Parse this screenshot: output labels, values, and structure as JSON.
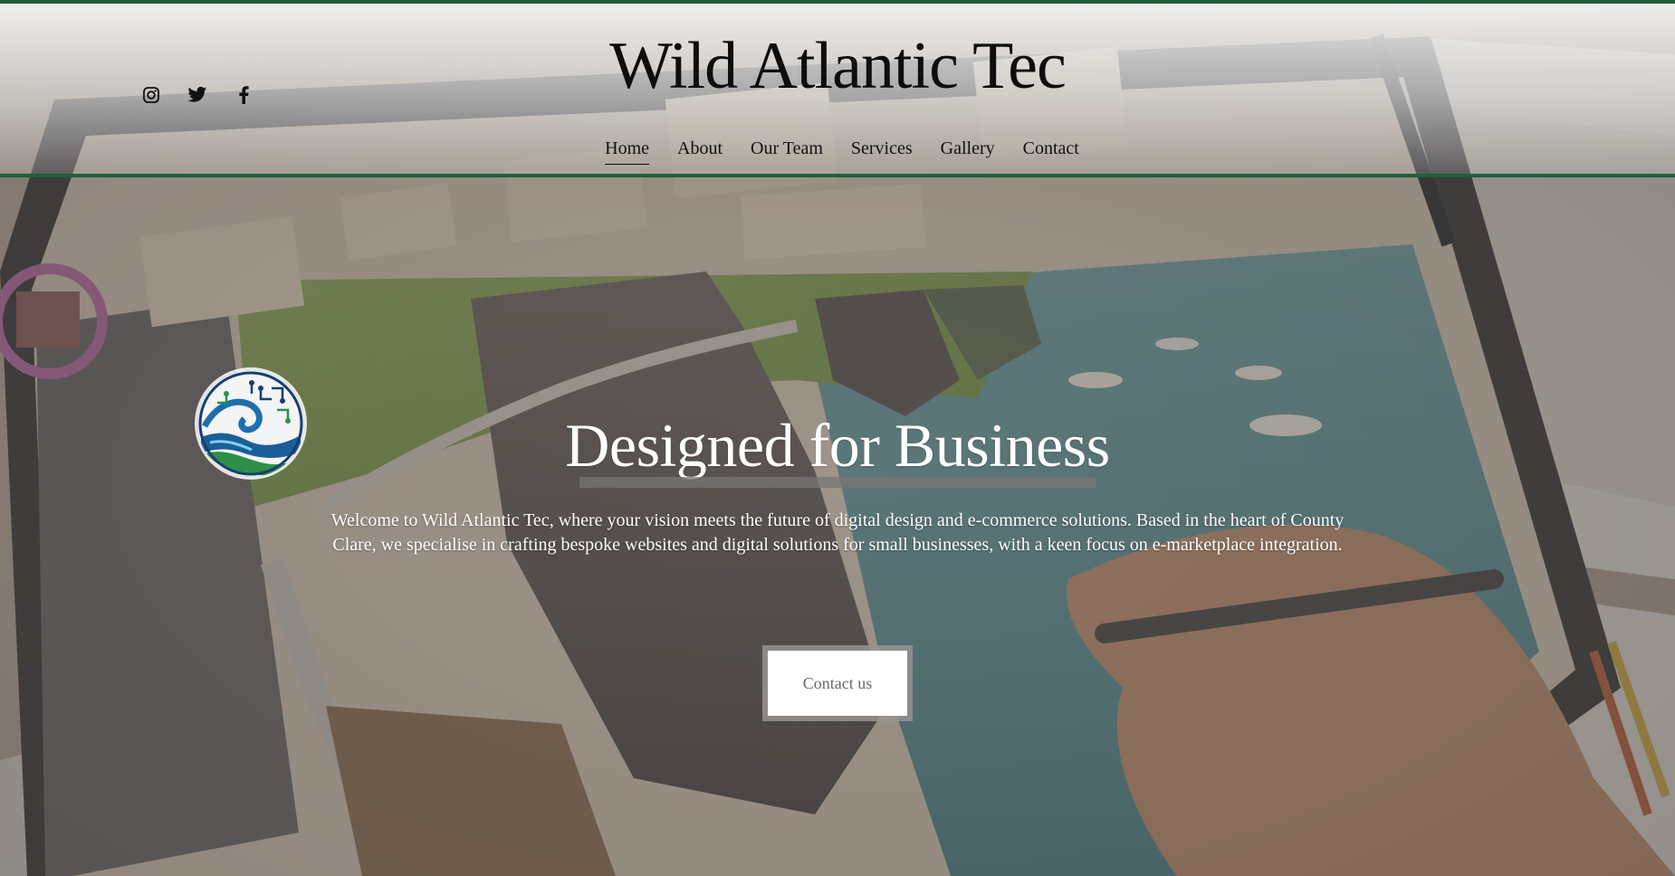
{
  "header": {
    "site_title": "Wild Atlantic Tec",
    "social": [
      {
        "icon": "instagram-icon"
      },
      {
        "icon": "twitter-icon"
      },
      {
        "icon": "facebook-icon"
      }
    ],
    "nav": [
      {
        "label": "Home",
        "active": true
      },
      {
        "label": "About",
        "active": false
      },
      {
        "label": "Our Team",
        "active": false
      },
      {
        "label": "Services",
        "active": false
      },
      {
        "label": "Gallery",
        "active": false
      },
      {
        "label": "Contact",
        "active": false
      }
    ]
  },
  "hero": {
    "heading": "Designed for Business",
    "intro": "Welcome to Wild Atlantic Tec, where your vision meets the future of digital design and e-commerce solutions. Based in the heart of County Clare, we specialise in crafting bespoke websites and digital solutions for small businesses, with a keen focus on e-marketplace integration.",
    "cta_label": "Contact us",
    "logo_icon": "wave-circuit-logo-icon"
  },
  "colors": {
    "accent_green": "#1f5f3c",
    "text_dark": "#111111",
    "hero_text": "#ffffff"
  }
}
